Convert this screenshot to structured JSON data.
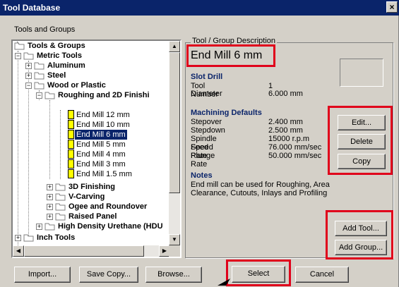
{
  "window": {
    "title": "Tool Database",
    "close": "×"
  },
  "tree": {
    "label": "Tools and Groups",
    "nodes": [
      {
        "text": "Tools & Groups",
        "bold": true
      },
      {
        "text": "Metric Tools",
        "bold": true
      },
      {
        "text": "Aluminum",
        "bold": true
      },
      {
        "text": "Steel",
        "bold": true
      },
      {
        "text": "Wood or Plastic",
        "bold": true
      },
      {
        "text": "Roughing and 2D Finishi",
        "bold": true
      },
      {
        "text": "End Mill 12 mm"
      },
      {
        "text": "End Mill 10 mm"
      },
      {
        "text": "End Mill 6 mm",
        "selected": true
      },
      {
        "text": "End Mill 5 mm"
      },
      {
        "text": "End Mill 4 mm"
      },
      {
        "text": "End Mill 3 mm"
      },
      {
        "text": "End Mill 1.5 mm"
      },
      {
        "text": "3D Finishing",
        "bold": true
      },
      {
        "text": "V-Carving",
        "bold": true
      },
      {
        "text": "Ogee and Roundover",
        "bold": true
      },
      {
        "text": "Raised Panel",
        "bold": true
      },
      {
        "text": "High Density Urethane (HDU",
        "bold": true
      },
      {
        "text": "Inch Tools",
        "bold": true
      }
    ]
  },
  "description": {
    "legend": "Tool / Group Description",
    "tool_name": "End Mill 6 mm",
    "tool_type": "Slot Drill",
    "tool_number_label": "Tool Number",
    "tool_number": "1",
    "diameter_label": "Diameter",
    "diameter": "6.000 mm",
    "machining_heading": "Machining Defaults",
    "stepover_label": "Stepover",
    "stepover": "2.400 mm",
    "stepdown_label": "Stepdown",
    "stepdown": "2.500 mm",
    "spindle_label": "Spindle Speed",
    "spindle": "15000 r.p.m",
    "feed_label": "Feed Rate",
    "feed": "76.000 mm/sec",
    "plunge_label": "Plunge Rate",
    "plunge": "50.000 mm/sec",
    "notes_heading": "Notes",
    "notes_line1": "End mill can be used for Roughing, Area",
    "notes_line2": "Clearance, Cutouts, Inlays and Profiling"
  },
  "buttons": {
    "edit": "Edit...",
    "delete": "Delete",
    "copy": "Copy",
    "add_tool": "Add Tool...",
    "add_group": "Add Group...",
    "import": "Import...",
    "save_copy": "Save Copy...",
    "browse": "Browse...",
    "select": "Select",
    "cancel": "Cancel"
  },
  "colors": {
    "highlight": "#e0001b",
    "titlebar": "#0a246a",
    "selection": "#0a246a"
  }
}
